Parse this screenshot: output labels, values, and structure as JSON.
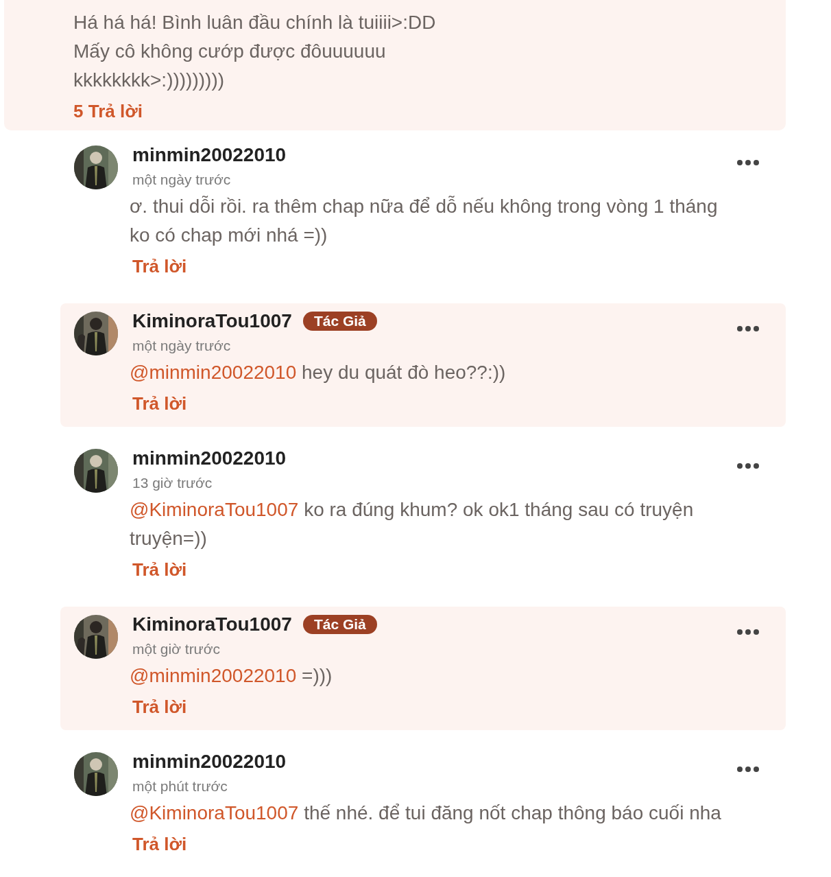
{
  "top_comment": {
    "lines": [
      "Há há há! Bình luân đầu chính là tuiiii>:DD",
      "Mấy cô không cướp được đôuuuuuu",
      "kkkkkkkk>:)))))))))"
    ],
    "replies_link": "5 Trả lời"
  },
  "replies": [
    {
      "user": "minmin20022010",
      "author": false,
      "time": "một ngày trước",
      "text": "ơ. thui dỗi rồi. ra thêm chap nữa để dỗ nếu không trong vòng 1 tháng ko có chap mới nhá =))",
      "reply": "Trả lời"
    },
    {
      "user": "KiminoraTou1007",
      "author": true,
      "badge": "Tác Giả",
      "time": "một ngày trước",
      "mention": "@minmin20022010",
      "text": "hey du quát đò heo??:))",
      "reply": "Trả lời"
    },
    {
      "user": "minmin20022010",
      "author": false,
      "time": "13 giờ trước",
      "mention": "@KiminoraTou1007",
      "text": "ko ra đúng khum? ok ok1 tháng sau có truyện truyện=))",
      "reply": "Trả lời"
    },
    {
      "user": "KiminoraTou1007",
      "author": true,
      "badge": "Tác Giả",
      "time": "một giờ trước",
      "mention": "@minmin20022010",
      "text": "=)))",
      "reply": "Trả lời"
    },
    {
      "user": "minmin20022010",
      "author": false,
      "time": "một phút trước",
      "mention": "@KiminoraTou1007",
      "text": "thế nhé. để tui đăng nốt chap thông báo cuối nha",
      "reply": "Trả lời"
    }
  ]
}
